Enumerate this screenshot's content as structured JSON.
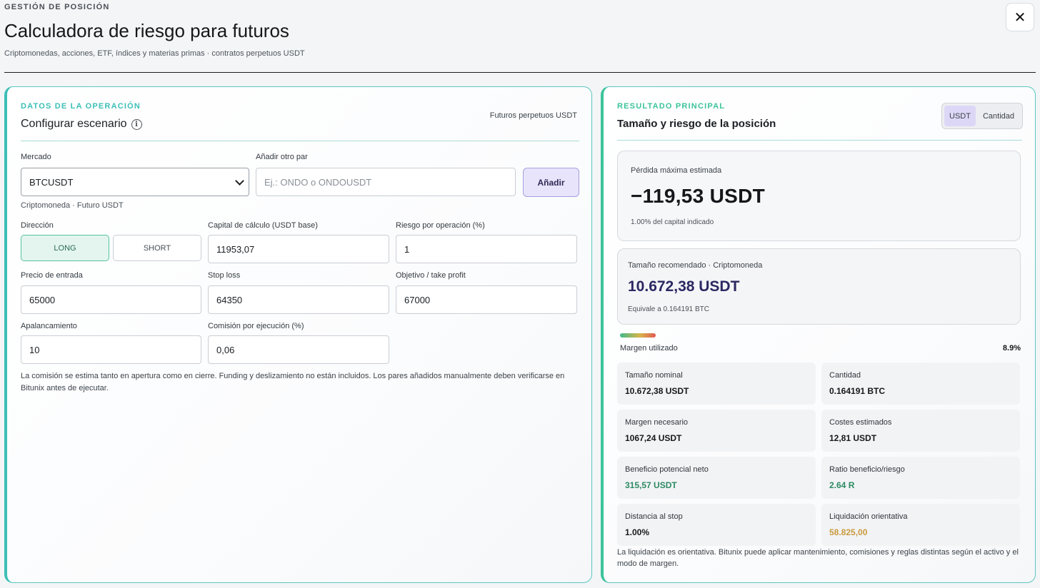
{
  "header": {
    "eyebrow": "GESTIÓN DE POSICIÓN",
    "title": "Calculadora de riesgo para futuros",
    "subtitle": "Criptomonedas, acciones, ETF, índices y materias primas · contratos perpetuos USDT",
    "close_label": "✕"
  },
  "left_panel": {
    "kicker": "DATOS DE LA OPERACIÓN",
    "title": "Configurar escenario",
    "context": "Futuros perpetuos USDT",
    "market": {
      "label": "Mercado",
      "value": "BTCUSDT",
      "hint": "Criptomoneda · Futuro USDT"
    },
    "add_pair": {
      "label": "Añadir otro par",
      "placeholder": "Ej.: ONDO o ONDOUSDT",
      "button": "Añadir"
    },
    "direction": {
      "label": "Dirección",
      "options": [
        "LONG",
        "SHORT"
      ],
      "selected": "LONG"
    },
    "capital": {
      "label": "Capital de cálculo (USDT base)",
      "value": "11953,07"
    },
    "risk": {
      "label": "Riesgo por operación (%)",
      "value": "1"
    },
    "entry": {
      "label": "Precio de entrada",
      "value": "65000"
    },
    "stop": {
      "label": "Stop loss",
      "value": "64350"
    },
    "target": {
      "label": "Objetivo / take profit",
      "value": "67000"
    },
    "leverage": {
      "label": "Apalancamiento",
      "value": "10"
    },
    "fee": {
      "label": "Comisión por ejecución (%)",
      "value": "0,06"
    },
    "note": "La comisión se estima tanto en apertura como en cierre. Funding y deslizamiento no están incluidos. Los pares añadidos manualmente deben verificarse en Bitunix antes de ejecutar."
  },
  "right_panel": {
    "kicker": "RESULTADO PRINCIPAL",
    "title": "Tamaño y riesgo de la posición",
    "unit_switch": {
      "options": [
        "USDT",
        "Cantidad"
      ],
      "selected": "USDT"
    },
    "max_loss": {
      "label": "Pérdida máxima estimada",
      "value": "−119,53 USDT",
      "sub": "1.00% del capital indicado"
    },
    "recommended": {
      "label": "Tamaño recomendado · Criptomoneda",
      "value": "10.672,38 USDT",
      "sub": "Equivale a 0.164191 BTC"
    },
    "margin_used": {
      "label": "Margen utilizado",
      "value": "8.9%",
      "fraction": 0.089
    },
    "metrics": [
      {
        "label": "Tamaño nominal",
        "value": "10.672,38 USDT",
        "tone": "default"
      },
      {
        "label": "Cantidad",
        "value": "0.164191 BTC",
        "tone": "default"
      },
      {
        "label": "Margen necesario",
        "value": "1067,24 USDT",
        "tone": "default"
      },
      {
        "label": "Costes estimados",
        "value": "12,81 USDT",
        "tone": "default"
      },
      {
        "label": "Beneficio potencial neto",
        "value": "315,57 USDT",
        "tone": "green"
      },
      {
        "label": "Ratio beneficio/riesgo",
        "value": "2.64 R",
        "tone": "green"
      },
      {
        "label": "Distancia al stop",
        "value": "1.00%",
        "tone": "default"
      },
      {
        "label": "Liquidación orientativa",
        "value": "58.825,00",
        "tone": "amber"
      }
    ],
    "note": "La liquidación es orientativa. Bitunix puede aplicar mantenimiento, comisiones y reglas distintas según el activo y el modo de margen."
  },
  "colors": {
    "accent_teal": "#3cbfb6",
    "accent_green": "#3cc39a",
    "positive": "#2d8a63",
    "warning": "#c99a3c",
    "primary_value": "#2b2862"
  }
}
